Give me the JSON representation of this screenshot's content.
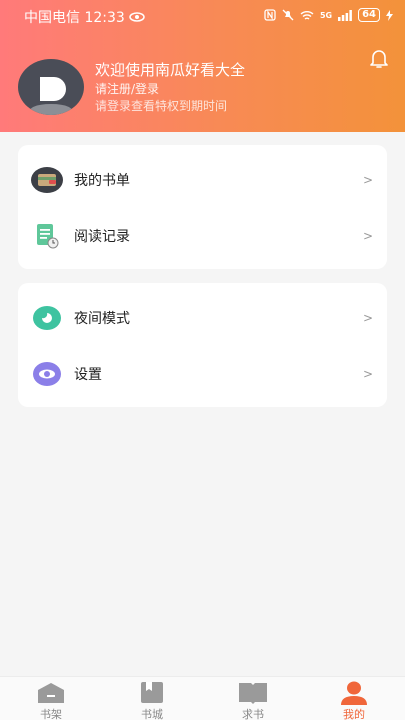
{
  "status_bar": {
    "carrier_time": "中国电信 12:33",
    "network": "5G",
    "battery": "64"
  },
  "header": {
    "welcome": "欢迎使用南瓜好看大全",
    "register_login": "请注册/登录",
    "privilege_hint": "请登录查看特权到期时间"
  },
  "menu_group_1": [
    {
      "label": "我的书单"
    },
    {
      "label": "阅读记录"
    }
  ],
  "menu_group_2": [
    {
      "label": "夜间模式"
    },
    {
      "label": "设置"
    }
  ],
  "chevron": ">",
  "tabbar": [
    {
      "label": "书架",
      "icon": "bookshelf-icon"
    },
    {
      "label": "书城",
      "icon": "bookstore-icon"
    },
    {
      "label": "求书",
      "icon": "request-book-icon"
    },
    {
      "label": "我的",
      "icon": "profile-icon",
      "active": true
    }
  ],
  "colors": {
    "header_gradient_start": "#ff7a7a",
    "header_gradient_end": "#f3923a",
    "accent": "#f0663a"
  }
}
